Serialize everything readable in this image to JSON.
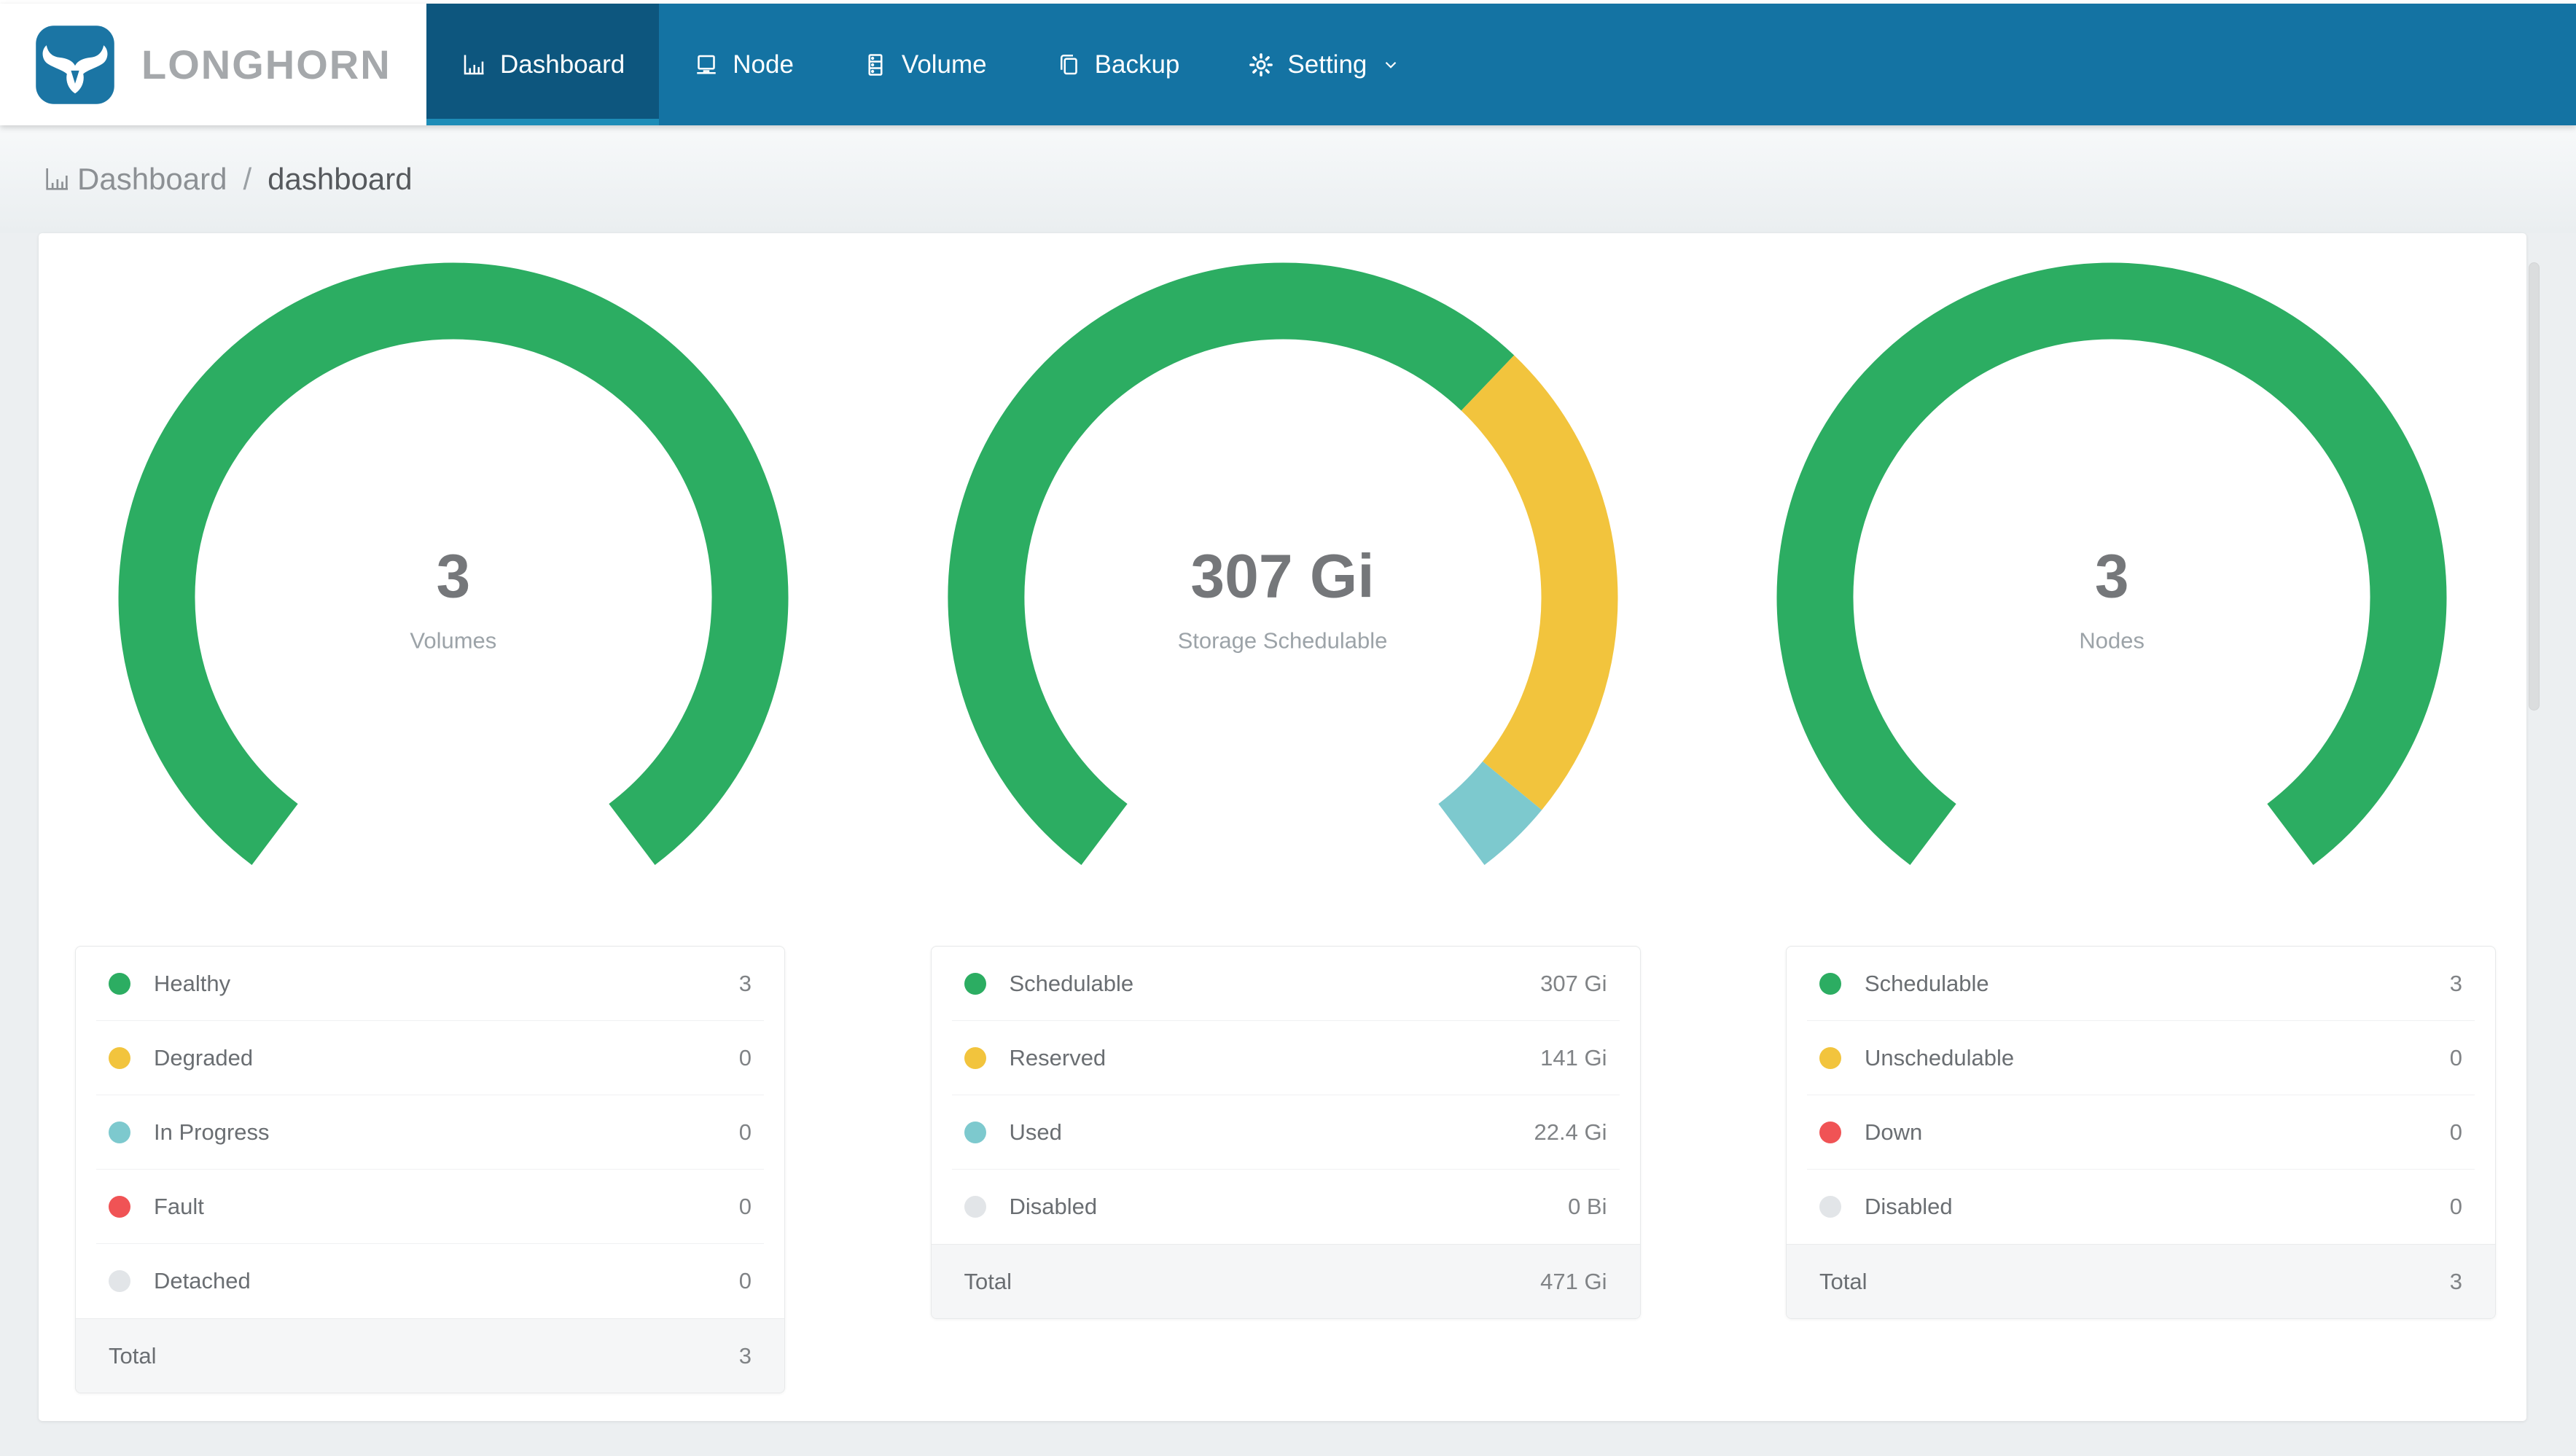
{
  "navbar": {
    "brand": "LONGHORN",
    "items": [
      {
        "label": "Dashboard",
        "icon": "bar-chart-icon",
        "active": true
      },
      {
        "label": "Node",
        "icon": "node-icon",
        "active": false
      },
      {
        "label": "Volume",
        "icon": "volume-icon",
        "active": false
      },
      {
        "label": "Backup",
        "icon": "backup-icon",
        "active": false
      },
      {
        "label": "Setting",
        "icon": "gear-icon",
        "active": false,
        "dropdown": true
      }
    ]
  },
  "breadcrumb": {
    "section": "Dashboard",
    "separator": "/",
    "current": "dashboard"
  },
  "colors": {
    "navbar": "#1473A3",
    "active_tab": "#0D567E",
    "active_underline": "#1D8CB7",
    "logo_blue": "#1B75A4",
    "green": "#2CAD62",
    "yellow": "#F2C43D",
    "teal": "#7DC9CE",
    "red": "#F05355",
    "gray": "#E2E5E8"
  },
  "chart_data": [
    {
      "type": "donut-gauge",
      "title": "Volumes",
      "center_value": "3",
      "start_angle_deg": 217,
      "sweep_deg": 286,
      "segments": [
        {
          "label": "Healthy",
          "value": 3,
          "display": "3",
          "color": "#2CAD62"
        },
        {
          "label": "Degraded",
          "value": 0,
          "display": "0",
          "color": "#F2C43D"
        },
        {
          "label": "In Progress",
          "value": 0,
          "display": "0",
          "color": "#7DC9CE"
        },
        {
          "label": "Fault",
          "value": 0,
          "display": "0",
          "color": "#F05355"
        },
        {
          "label": "Detached",
          "value": 0,
          "display": "0",
          "color": "#E2E5E8"
        }
      ],
      "total_label": "Total",
      "total_display": "3"
    },
    {
      "type": "donut-gauge",
      "title": "Storage Schedulable",
      "center_value": "307 Gi",
      "start_angle_deg": 217,
      "sweep_deg": 286,
      "segments": [
        {
          "label": "Schedulable",
          "value": 307,
          "display": "307 Gi",
          "color": "#2CAD62"
        },
        {
          "label": "Reserved",
          "value": 141,
          "display": "141 Gi",
          "color": "#F2C43D"
        },
        {
          "label": "Used",
          "value": 22.4,
          "display": "22.4 Gi",
          "color": "#7DC9CE"
        },
        {
          "label": "Disabled",
          "value": 0,
          "display": "0 Bi",
          "color": "#E2E5E8"
        }
      ],
      "total_label": "Total",
      "total_display": "471 Gi"
    },
    {
      "type": "donut-gauge",
      "title": "Nodes",
      "center_value": "3",
      "start_angle_deg": 217,
      "sweep_deg": 286,
      "segments": [
        {
          "label": "Schedulable",
          "value": 3,
          "display": "3",
          "color": "#2CAD62"
        },
        {
          "label": "Unschedulable",
          "value": 0,
          "display": "0",
          "color": "#F2C43D"
        },
        {
          "label": "Down",
          "value": 0,
          "display": "0",
          "color": "#F05355"
        },
        {
          "label": "Disabled",
          "value": 0,
          "display": "0",
          "color": "#E2E5E8"
        }
      ],
      "total_label": "Total",
      "total_display": "3"
    }
  ]
}
